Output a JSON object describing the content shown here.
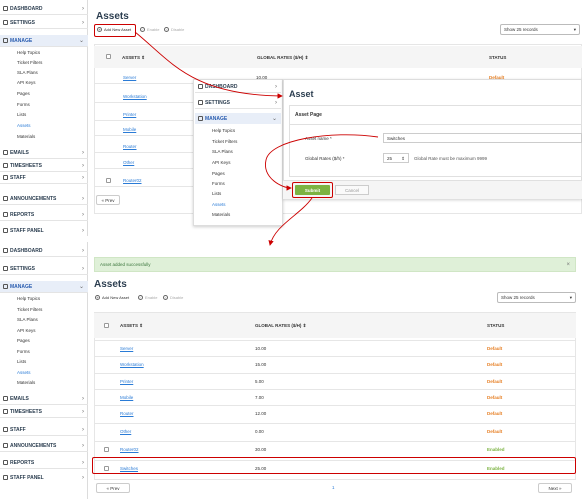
{
  "colors": {
    "link": "#2a7bd6",
    "default_status": "#e67e22",
    "enabled_status": "#7cb342",
    "red_highlight": "#cc0000",
    "green_button": "#7cb342",
    "alert_bg": "#dff0d8"
  },
  "sidebar": {
    "items": [
      {
        "label": "DASHBOARD",
        "icon": "dashboard-icon"
      },
      {
        "label": "SETTINGS",
        "icon": "gear-icon"
      },
      {
        "label": "MANAGE",
        "icon": "manage-icon"
      },
      {
        "label": "EMAILS",
        "icon": "mail-icon"
      },
      {
        "label": "TIMESHEETS",
        "icon": "clock-icon"
      },
      {
        "label": "STAFF",
        "icon": "user-icon"
      },
      {
        "label": "ANNOUNCEMENTS",
        "icon": "megaphone-icon"
      },
      {
        "label": "REPORTS",
        "icon": "chart-icon"
      },
      {
        "label": "STAFF PANEL",
        "icon": "staff-panel-icon"
      }
    ],
    "sub": [
      "Help Topics",
      "Ticket Filters",
      "SLA Plans",
      "API Keys",
      "Pages",
      "Forms",
      "Lists",
      "Assets",
      "Materials"
    ]
  },
  "top": {
    "title": "Assets",
    "add_label": "Add New Asset",
    "enable_label": "Enable",
    "disable_label": "Disable",
    "show_label": "Show 25 records",
    "col_assets": "ASSETS ⇕",
    "col_rates": "GLOBAL RATES ($/H) ⇕",
    "col_status": "STATUS",
    "rate0": "10.00",
    "status0": "Default",
    "assets": [
      "Server",
      "Workstation",
      "Printer",
      "Mobile",
      "Router",
      "Other",
      "Router02"
    ],
    "prev": "« Prev"
  },
  "form": {
    "title": "Asset",
    "section": "Asset Page",
    "name_label": "Asset name *",
    "name_value": "Switches",
    "rate_label": "Global Rates ($/h) *",
    "rate_value": "25",
    "rate_hint": "Global Rate must be maximum 9999",
    "submit": "Submit",
    "cancel": "Cancel"
  },
  "bottom": {
    "alert": "Asset added successfully",
    "title": "Assets",
    "add_label": "Add New Asset",
    "enable_label": "Enable",
    "disable_label": "Disable",
    "show_label": "Show 25 records",
    "col_assets": "ASSETS ⇕",
    "col_rates": "GLOBAL RATES ($/H) ⇕",
    "col_status": "STATUS",
    "rows": [
      {
        "name": "Server",
        "rate": "10.00",
        "status": "Default"
      },
      {
        "name": "Workstation",
        "rate": "15.00",
        "status": "Default"
      },
      {
        "name": "Printer",
        "rate": "5.00",
        "status": "Default"
      },
      {
        "name": "Mobile",
        "rate": "7.00",
        "status": "Default"
      },
      {
        "name": "Router",
        "rate": "12.00",
        "status": "Default"
      },
      {
        "name": "Other",
        "rate": "0.00",
        "status": "Default"
      },
      {
        "name": "Router02",
        "rate": "30.00",
        "status": "Enabled"
      },
      {
        "name": "Switches",
        "rate": "25.00",
        "status": "Enabled"
      }
    ],
    "prev": "« Prev",
    "page": "1",
    "next": "Next »"
  }
}
